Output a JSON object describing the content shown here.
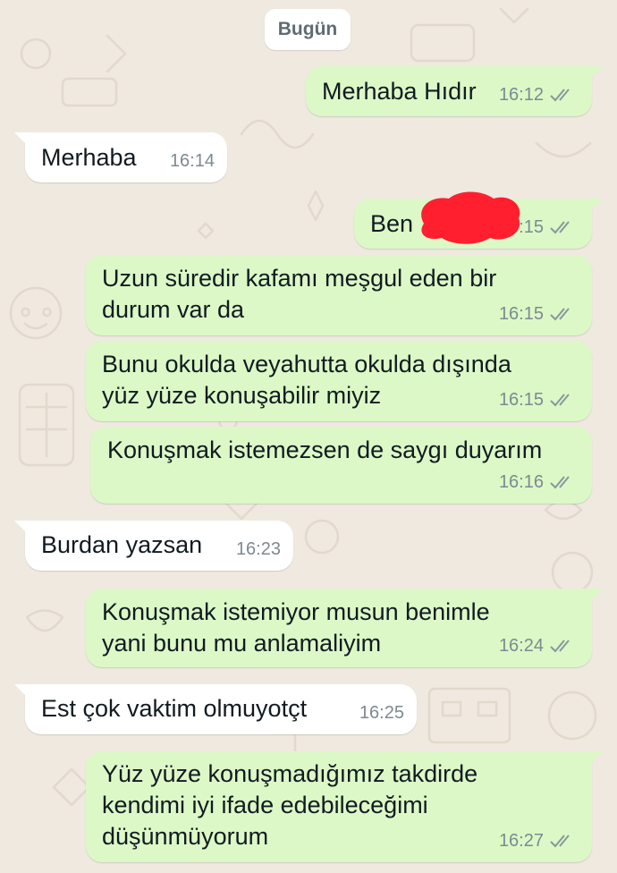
{
  "chat": {
    "date_label": "Bugün",
    "messages": [
      {
        "direction": "outgoing",
        "text": "Merhaba Hıdır",
        "time": "16:12",
        "status": "read"
      },
      {
        "direction": "incoming",
        "text": "Merhaba",
        "time": "16:14"
      },
      {
        "direction": "outgoing",
        "text": "Ben",
        "time": "16:15",
        "status": "read",
        "redacted": true
      },
      {
        "direction": "outgoing",
        "text": "Uzun süredir kafamı meşgul eden bir\ndurum var da",
        "time": "16:15",
        "status": "read"
      },
      {
        "direction": "outgoing",
        "text": "Bunu okulda veyahutta okulda dışında\nyüz yüze konuşabilir miyiz",
        "time": "16:15",
        "status": "read"
      },
      {
        "direction": "outgoing",
        "text": "Konuşmak istemezsen de saygı duyarım",
        "time": "16:16",
        "status": "read"
      },
      {
        "direction": "incoming",
        "text": "Burdan yazsan",
        "time": "16:23"
      },
      {
        "direction": "outgoing",
        "text": "Konuşmak istemiyor musun benimle\nyani bunu mu anlamaliyim",
        "time": "16:24",
        "status": "read"
      },
      {
        "direction": "incoming",
        "text": "Est çok vaktim olmuyotçt",
        "time": "16:25"
      },
      {
        "direction": "outgoing",
        "text": "Yüz yüze konuşmadığımız takdirde\nkendimi iyi ifade edebileceğimi\ndüşünmüyorum",
        "time": "16:27",
        "status": "read"
      }
    ]
  },
  "colors": {
    "wallpaper": "#efe9e0",
    "outgoing_bubble": "#dcf8c6",
    "incoming_bubble": "#ffffff",
    "read_tick": "#8a969c",
    "redaction": "#ff1f2e"
  },
  "icons": {
    "read_receipt": "double-check-icon"
  }
}
